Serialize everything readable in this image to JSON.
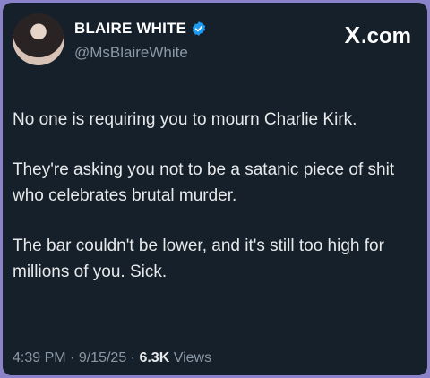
{
  "author": {
    "display_name": "BLAIRE WHITE",
    "handle": "@MsBlaireWhite",
    "avatar_icon": "profile-photo",
    "verified_icon": "verified-badge-icon",
    "verified_color": "#1d9bf0"
  },
  "brand": {
    "mark": "X",
    "domain": ".com"
  },
  "tweet": {
    "paragraphs": [
      "No one is requiring you to mourn Charlie Kirk.",
      "They're asking you not to be a satanic piece of shit who celebrates brutal murder.",
      "The bar couldn't be lower, and it's still too high for millions of you. Sick."
    ]
  },
  "meta": {
    "time": "4:39 PM",
    "separator": "·",
    "date": "9/15/25",
    "views_count": "6.3K",
    "views_label": "Views"
  },
  "colors": {
    "background": "#15202b",
    "border": "#8a83c9",
    "text": "#e7e9ea",
    "muted": "#8b98a5"
  }
}
